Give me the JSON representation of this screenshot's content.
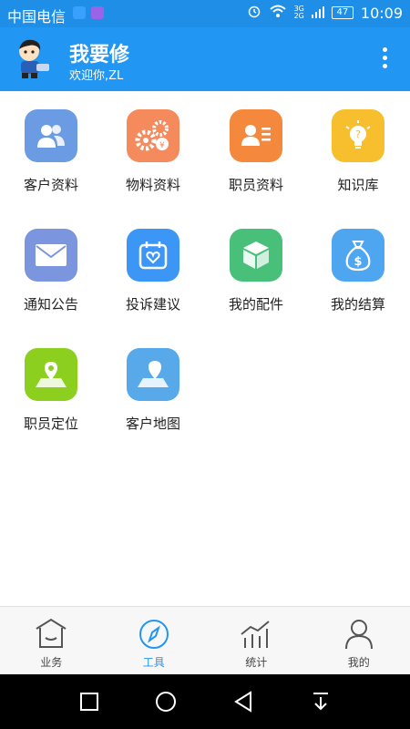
{
  "status": {
    "carrier": "中国电信",
    "network": [
      "3G",
      "2G"
    ],
    "battery": "47",
    "time": "10:09"
  },
  "header": {
    "title": "我要修",
    "subtitle": "欢迎你,ZL"
  },
  "tiles": [
    {
      "label": "客户资料",
      "icon": "customers-icon",
      "color": "#6a9be3"
    },
    {
      "label": "物料资料",
      "icon": "gears-icon",
      "color": "#f58a5d"
    },
    {
      "label": "职员资料",
      "icon": "staff-card-icon",
      "color": "#f4893d"
    },
    {
      "label": "知识库",
      "icon": "lightbulb-icon",
      "color": "#f7bf2e"
    },
    {
      "label": "通知公告",
      "icon": "mail-icon",
      "color": "#7b95de"
    },
    {
      "label": "投诉建议",
      "icon": "calendar-heart-icon",
      "color": "#3b96f5"
    },
    {
      "label": "我的配件",
      "icon": "box-icon",
      "color": "#49c07a"
    },
    {
      "label": "我的结算",
      "icon": "money-bag-icon",
      "color": "#4fa6f0"
    },
    {
      "label": "职员定位",
      "icon": "map-pin-icon",
      "color": "#8ccf1e"
    },
    {
      "label": "客户地图",
      "icon": "map-pin-icon",
      "color": "#58a9ea"
    }
  ],
  "nav": [
    {
      "label": "业务",
      "icon": "home-icon"
    },
    {
      "label": "工具",
      "icon": "compass-icon",
      "active": true
    },
    {
      "label": "统计",
      "icon": "chart-icon"
    },
    {
      "label": "我的",
      "icon": "user-icon"
    }
  ],
  "colors": {
    "statusbar": "#1f8ee6",
    "appbar": "#2196f3",
    "accent": "#2196f3"
  }
}
